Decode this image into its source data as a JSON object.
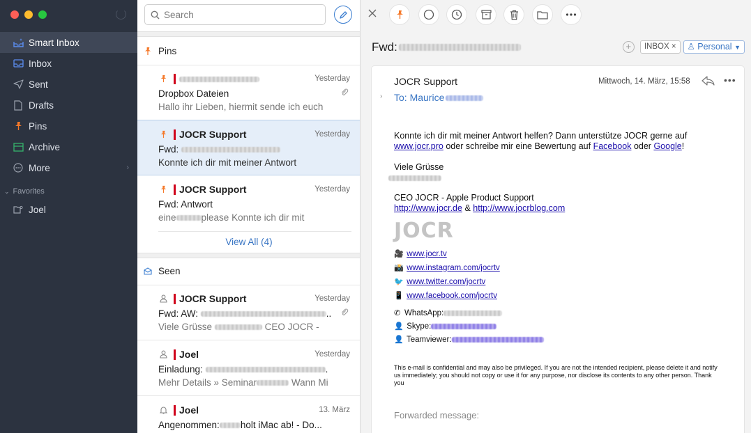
{
  "sidebar": {
    "items": [
      {
        "label": "Smart Inbox",
        "icon": "smart-inbox-icon",
        "color": "#5b8def"
      },
      {
        "label": "Inbox",
        "icon": "inbox-icon",
        "color": "#5b8def"
      },
      {
        "label": "Sent",
        "icon": "sent-icon",
        "color": "#9aa1ad"
      },
      {
        "label": "Drafts",
        "icon": "drafts-icon",
        "color": "#9aa1ad"
      },
      {
        "label": "Pins",
        "icon": "pin-icon",
        "color": "#f5792a"
      },
      {
        "label": "Archive",
        "icon": "archive-icon",
        "color": "#37b36b"
      },
      {
        "label": "More",
        "icon": "more-icon",
        "color": "#9aa1ad"
      }
    ],
    "favorites_header": "Favorites",
    "favorites": [
      {
        "label": "Joel",
        "icon": "folder-person-icon"
      }
    ]
  },
  "list": {
    "search_placeholder": "Search",
    "pins_header": "Pins",
    "pinned": [
      {
        "from": "",
        "time": "Yesterday",
        "subject": "Dropbox Dateien",
        "preview": "Hallo ihr Lieben, hiermit sende ich euch",
        "attachment": true
      },
      {
        "from": "JOCR Support",
        "time": "Yesterday",
        "subject": "Fwd:",
        "preview": "Konnte ich dir mit meiner Antwort",
        "selected": true
      },
      {
        "from": "JOCR Support",
        "time": "Yesterday",
        "subject": "Fwd: Antwort",
        "preview_a": "eine",
        "preview_b": "please Konnte ich dir mit"
      }
    ],
    "view_all": "View All (4)",
    "seen_header": "Seen",
    "seen": [
      {
        "from": "JOCR Support",
        "time": "Yesterday",
        "subject": "Fwd: AW:",
        "subject_tail": "..",
        "preview_a": "Viele Grüsse",
        "preview_b": "CEO JOCR -",
        "attachment": true
      },
      {
        "from": "Joel",
        "time": "Yesterday",
        "subject": "Einladung:",
        "subject_tail": ".",
        "preview_a": "Mehr Details » Seminar",
        "preview_b": "Wann Mi"
      },
      {
        "from": "Joel",
        "time": "13. März",
        "subject": "Angenommen:",
        "subject_tail": "holt iMac ab! - Do..."
      }
    ]
  },
  "reader": {
    "title": "Fwd:",
    "tags": {
      "inbox": "INBOX",
      "account": "Personal"
    },
    "sender": "JOCR Support",
    "date": "Mittwoch, 14. März, 15:58",
    "to": "To: Maurice",
    "body": {
      "p1_a": "Konnte ich dir mit meiner Antwort helfen? Dann unterstütze JOCR gerne auf",
      "link_jocr_pro": "www.jocr.pro",
      "p1_b": " oder schreibe mir eine Bewertung auf ",
      "link_facebook": "Facebook",
      "p1_c": " oder ",
      "link_google": "Google",
      "p1_d": "!",
      "greeting": "Viele Grüsse",
      "role": "CEO JOCR - Apple Product Support",
      "link_site1": "http://www.jocr.de",
      "amp": " & ",
      "link_site2": "http://www.jocrblog.com",
      "logo": "JOCR",
      "social": [
        {
          "icon": "🎥",
          "text": "www.jocr.tv"
        },
        {
          "icon": "📸",
          "text": "www.instagram.com/jocrtv"
        },
        {
          "icon": "🐦",
          "text": "www.twitter.com/jocrtv"
        },
        {
          "icon": "📱",
          "text": "www.facebook.com/jocrtv"
        }
      ],
      "whatsapp": "WhatsApp:",
      "skype": "Skype:",
      "teamviewer": "Teamviewer:",
      "disclaimer": "This e-mail is confidential and may also be privileged. If you are not the intended recipient, please delete it and notify us immediately; you should not copy or use it for any purpose, nor disclose its contents to any other person. Thank you",
      "forwarded": "Forwarded message:"
    }
  }
}
